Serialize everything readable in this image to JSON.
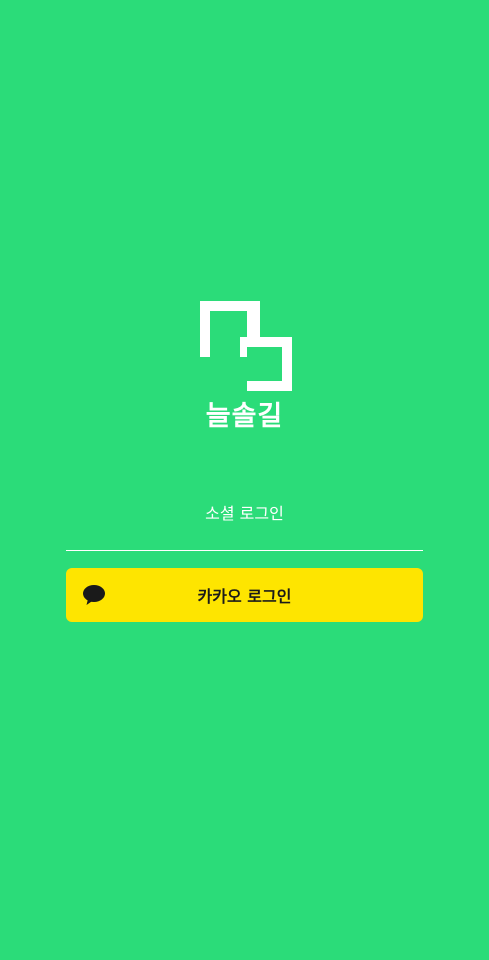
{
  "app": {
    "name": "늘솔길",
    "logo_icon": "folded-path-logo-icon"
  },
  "login": {
    "section_label": "소셜 로그인",
    "kakao_button_label": "카카오 로그인",
    "kakao_icon": "speech-bubble-icon"
  },
  "colors": {
    "background": "#2BDC79",
    "kakao_yellow": "#FEE500",
    "text_on_green": "#FFFFFF",
    "text_on_yellow": "#1A1A1A"
  }
}
